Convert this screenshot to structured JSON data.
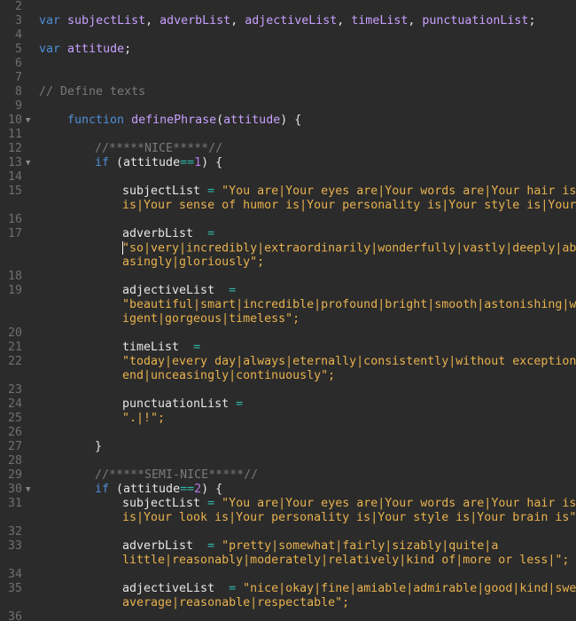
{
  "window": {
    "language": "javascript"
  },
  "lines": [
    {
      "n": "2",
      "indent": 0,
      "fold": false,
      "parts": []
    },
    {
      "n": "3",
      "indent": 0,
      "fold": false,
      "parts": [
        {
          "t": "var",
          "c": "k"
        },
        {
          "t": " ",
          "c": "t"
        },
        {
          "t": "subjectList",
          "c": "v"
        },
        {
          "t": ", ",
          "c": "t"
        },
        {
          "t": "adverbList",
          "c": "v"
        },
        {
          "t": ", ",
          "c": "t"
        },
        {
          "t": "adjectiveList",
          "c": "v"
        },
        {
          "t": ", ",
          "c": "t"
        },
        {
          "t": "timeList",
          "c": "v"
        },
        {
          "t": ", ",
          "c": "t"
        },
        {
          "t": "punctuationList",
          "c": "v"
        },
        {
          "t": ";",
          "c": "t"
        }
      ]
    },
    {
      "n": "4",
      "indent": 0,
      "fold": false,
      "parts": []
    },
    {
      "n": "5",
      "indent": 0,
      "fold": false,
      "parts": [
        {
          "t": "var",
          "c": "k"
        },
        {
          "t": " ",
          "c": "t"
        },
        {
          "t": "attitude",
          "c": "v"
        },
        {
          "t": ";",
          "c": "t"
        }
      ]
    },
    {
      "n": "6",
      "indent": 0,
      "fold": false,
      "parts": []
    },
    {
      "n": "7",
      "indent": 0,
      "fold": false,
      "parts": []
    },
    {
      "n": "8",
      "indent": 0,
      "fold": false,
      "parts": [
        {
          "t": "// Define texts",
          "c": "c"
        }
      ]
    },
    {
      "n": "9",
      "indent": 0,
      "fold": false,
      "parts": []
    },
    {
      "n": "10",
      "indent": 1,
      "fold": true,
      "parts": [
        {
          "t": "function",
          "c": "k"
        },
        {
          "t": " ",
          "c": "t"
        },
        {
          "t": "definePhrase",
          "c": "v"
        },
        {
          "t": "(",
          "c": "t"
        },
        {
          "t": "attitude",
          "c": "v"
        },
        {
          "t": ") {",
          "c": "t"
        }
      ]
    },
    {
      "n": "11",
      "indent": 0,
      "fold": false,
      "parts": []
    },
    {
      "n": "12",
      "indent": 2,
      "fold": false,
      "parts": [
        {
          "t": "//*****NICE*****//",
          "c": "c"
        }
      ]
    },
    {
      "n": "13",
      "indent": 2,
      "fold": true,
      "parts": [
        {
          "t": "if",
          "c": "k"
        },
        {
          "t": " (attitude",
          "c": "t"
        },
        {
          "t": "==",
          "c": "o"
        },
        {
          "t": "1",
          "c": "n"
        },
        {
          "t": ") {",
          "c": "t"
        }
      ]
    },
    {
      "n": "14",
      "indent": 0,
      "fold": false,
      "parts": []
    },
    {
      "n": "15",
      "indent": 3,
      "fold": false,
      "parts": [
        {
          "t": "subjectList",
          "c": "t"
        },
        {
          "t": " ",
          "c": "t"
        },
        {
          "t": "=",
          "c": "o"
        },
        {
          "t": " ",
          "c": "t"
        },
        {
          "t": "\"You are|Your eyes are|Your words are|Your hair is|Your smile",
          "c": "s"
        }
      ]
    },
    {
      "n": "",
      "indent": 3,
      "fold": false,
      "parts": [
        {
          "t": "is|Your sense of humor is|Your personality is|Your style is|Your mind is\";",
          "c": "s"
        }
      ]
    },
    {
      "n": "16",
      "indent": 0,
      "fold": false,
      "parts": []
    },
    {
      "n": "17",
      "indent": 3,
      "fold": false,
      "parts": [
        {
          "t": "adverbList",
          "c": "t"
        },
        {
          "t": "  ",
          "c": "t"
        },
        {
          "t": "=",
          "c": "o"
        }
      ]
    },
    {
      "n": "",
      "indent": 3,
      "fold": false,
      "caret": true,
      "parts": [
        {
          "t": "\"so|very|incredibly|extraordinarily|wonderfully|vastly|deeply|absolutely|amaz",
          "c": "s"
        }
      ]
    },
    {
      "n": "",
      "indent": 3,
      "fold": false,
      "parts": [
        {
          "t": "asingly|gloriously\";",
          "c": "s"
        }
      ]
    },
    {
      "n": "18",
      "indent": 0,
      "fold": false,
      "parts": []
    },
    {
      "n": "19",
      "indent": 3,
      "fold": false,
      "parts": [
        {
          "t": "adjectiveList",
          "c": "t"
        },
        {
          "t": "  ",
          "c": "t"
        },
        {
          "t": "=",
          "c": "o"
        }
      ]
    },
    {
      "n": "",
      "indent": 3,
      "fold": false,
      "parts": [
        {
          "t": "\"beautiful|smart|incredible|profound|bright|smooth|astonishing|wonderful|intell",
          "c": "s"
        }
      ]
    },
    {
      "n": "",
      "indent": 3,
      "fold": false,
      "parts": [
        {
          "t": "igent|gorgeous|timeless\";",
          "c": "s"
        }
      ]
    },
    {
      "n": "20",
      "indent": 0,
      "fold": false,
      "parts": []
    },
    {
      "n": "21",
      "indent": 3,
      "fold": false,
      "parts": [
        {
          "t": "timeList",
          "c": "t"
        },
        {
          "t": "  ",
          "c": "t"
        },
        {
          "t": "=",
          "c": "o"
        }
      ]
    },
    {
      "n": "22",
      "indent": 3,
      "fold": false,
      "parts": [
        {
          "t": "\"today|every day|always|eternally|consistently|without exception|in the",
          "c": "s"
        }
      ]
    },
    {
      "n": "",
      "indent": 3,
      "fold": false,
      "parts": [
        {
          "t": "end|unceasingly|continuously\";",
          "c": "s"
        }
      ]
    },
    {
      "n": "23",
      "indent": 0,
      "fold": false,
      "parts": []
    },
    {
      "n": "24",
      "indent": 3,
      "fold": false,
      "parts": [
        {
          "t": "punctuationList",
          "c": "t"
        },
        {
          "t": " ",
          "c": "t"
        },
        {
          "t": "=",
          "c": "o"
        }
      ]
    },
    {
      "n": "25",
      "indent": 3,
      "fold": false,
      "parts": [
        {
          "t": "\".|!\";",
          "c": "s"
        }
      ]
    },
    {
      "n": "26",
      "indent": 0,
      "fold": false,
      "parts": []
    },
    {
      "n": "27",
      "indent": 2,
      "fold": false,
      "parts": [
        {
          "t": "}",
          "c": "t"
        }
      ]
    },
    {
      "n": "28",
      "indent": 0,
      "fold": false,
      "parts": []
    },
    {
      "n": "29",
      "indent": 2,
      "fold": false,
      "parts": [
        {
          "t": "//*****SEMI-NICE*****//",
          "c": "c"
        }
      ]
    },
    {
      "n": "30",
      "indent": 2,
      "fold": true,
      "parts": [
        {
          "t": "if",
          "c": "k"
        },
        {
          "t": " (attitude",
          "c": "t"
        },
        {
          "t": "==",
          "c": "o"
        },
        {
          "t": "2",
          "c": "n"
        },
        {
          "t": ") {",
          "c": "t"
        }
      ]
    },
    {
      "n": "31",
      "indent": 3,
      "fold": false,
      "parts": [
        {
          "t": "subjectList",
          "c": "t"
        },
        {
          "t": " ",
          "c": "t"
        },
        {
          "t": "=",
          "c": "o"
        },
        {
          "t": " ",
          "c": "t"
        },
        {
          "t": "\"You are|Your eyes are|Your words are|Your hair is|Your smile",
          "c": "s"
        }
      ]
    },
    {
      "n": "",
      "indent": 3,
      "fold": false,
      "parts": [
        {
          "t": "is|Your look is|Your personality is|Your style is|Your brain is\";",
          "c": "s"
        }
      ]
    },
    {
      "n": "32",
      "indent": 0,
      "fold": false,
      "parts": []
    },
    {
      "n": "33",
      "indent": 3,
      "fold": false,
      "parts": [
        {
          "t": "adverbList",
          "c": "t"
        },
        {
          "t": "  ",
          "c": "t"
        },
        {
          "t": "=",
          "c": "o"
        },
        {
          "t": " ",
          "c": "t"
        },
        {
          "t": "\"pretty|somewhat|fairly|sizably|quite|a",
          "c": "s"
        }
      ]
    },
    {
      "n": "",
      "indent": 3,
      "fold": false,
      "parts": [
        {
          "t": "little|reasonably|moderately|relatively|kind of|more or less|\";",
          "c": "s"
        }
      ]
    },
    {
      "n": "34",
      "indent": 0,
      "fold": false,
      "parts": []
    },
    {
      "n": "35",
      "indent": 3,
      "fold": false,
      "parts": [
        {
          "t": "adjectiveList",
          "c": "t"
        },
        {
          "t": "  ",
          "c": "t"
        },
        {
          "t": "=",
          "c": "o"
        },
        {
          "t": " ",
          "c": "t"
        },
        {
          "t": "\"nice|okay|fine|amiable|admirable|good|kind|swell|above",
          "c": "s"
        }
      ]
    },
    {
      "n": "",
      "indent": 3,
      "fold": false,
      "parts": [
        {
          "t": "average|reasonable|respectable\";",
          "c": "s"
        }
      ]
    },
    {
      "n": "36",
      "indent": 0,
      "fold": false,
      "parts": []
    }
  ]
}
